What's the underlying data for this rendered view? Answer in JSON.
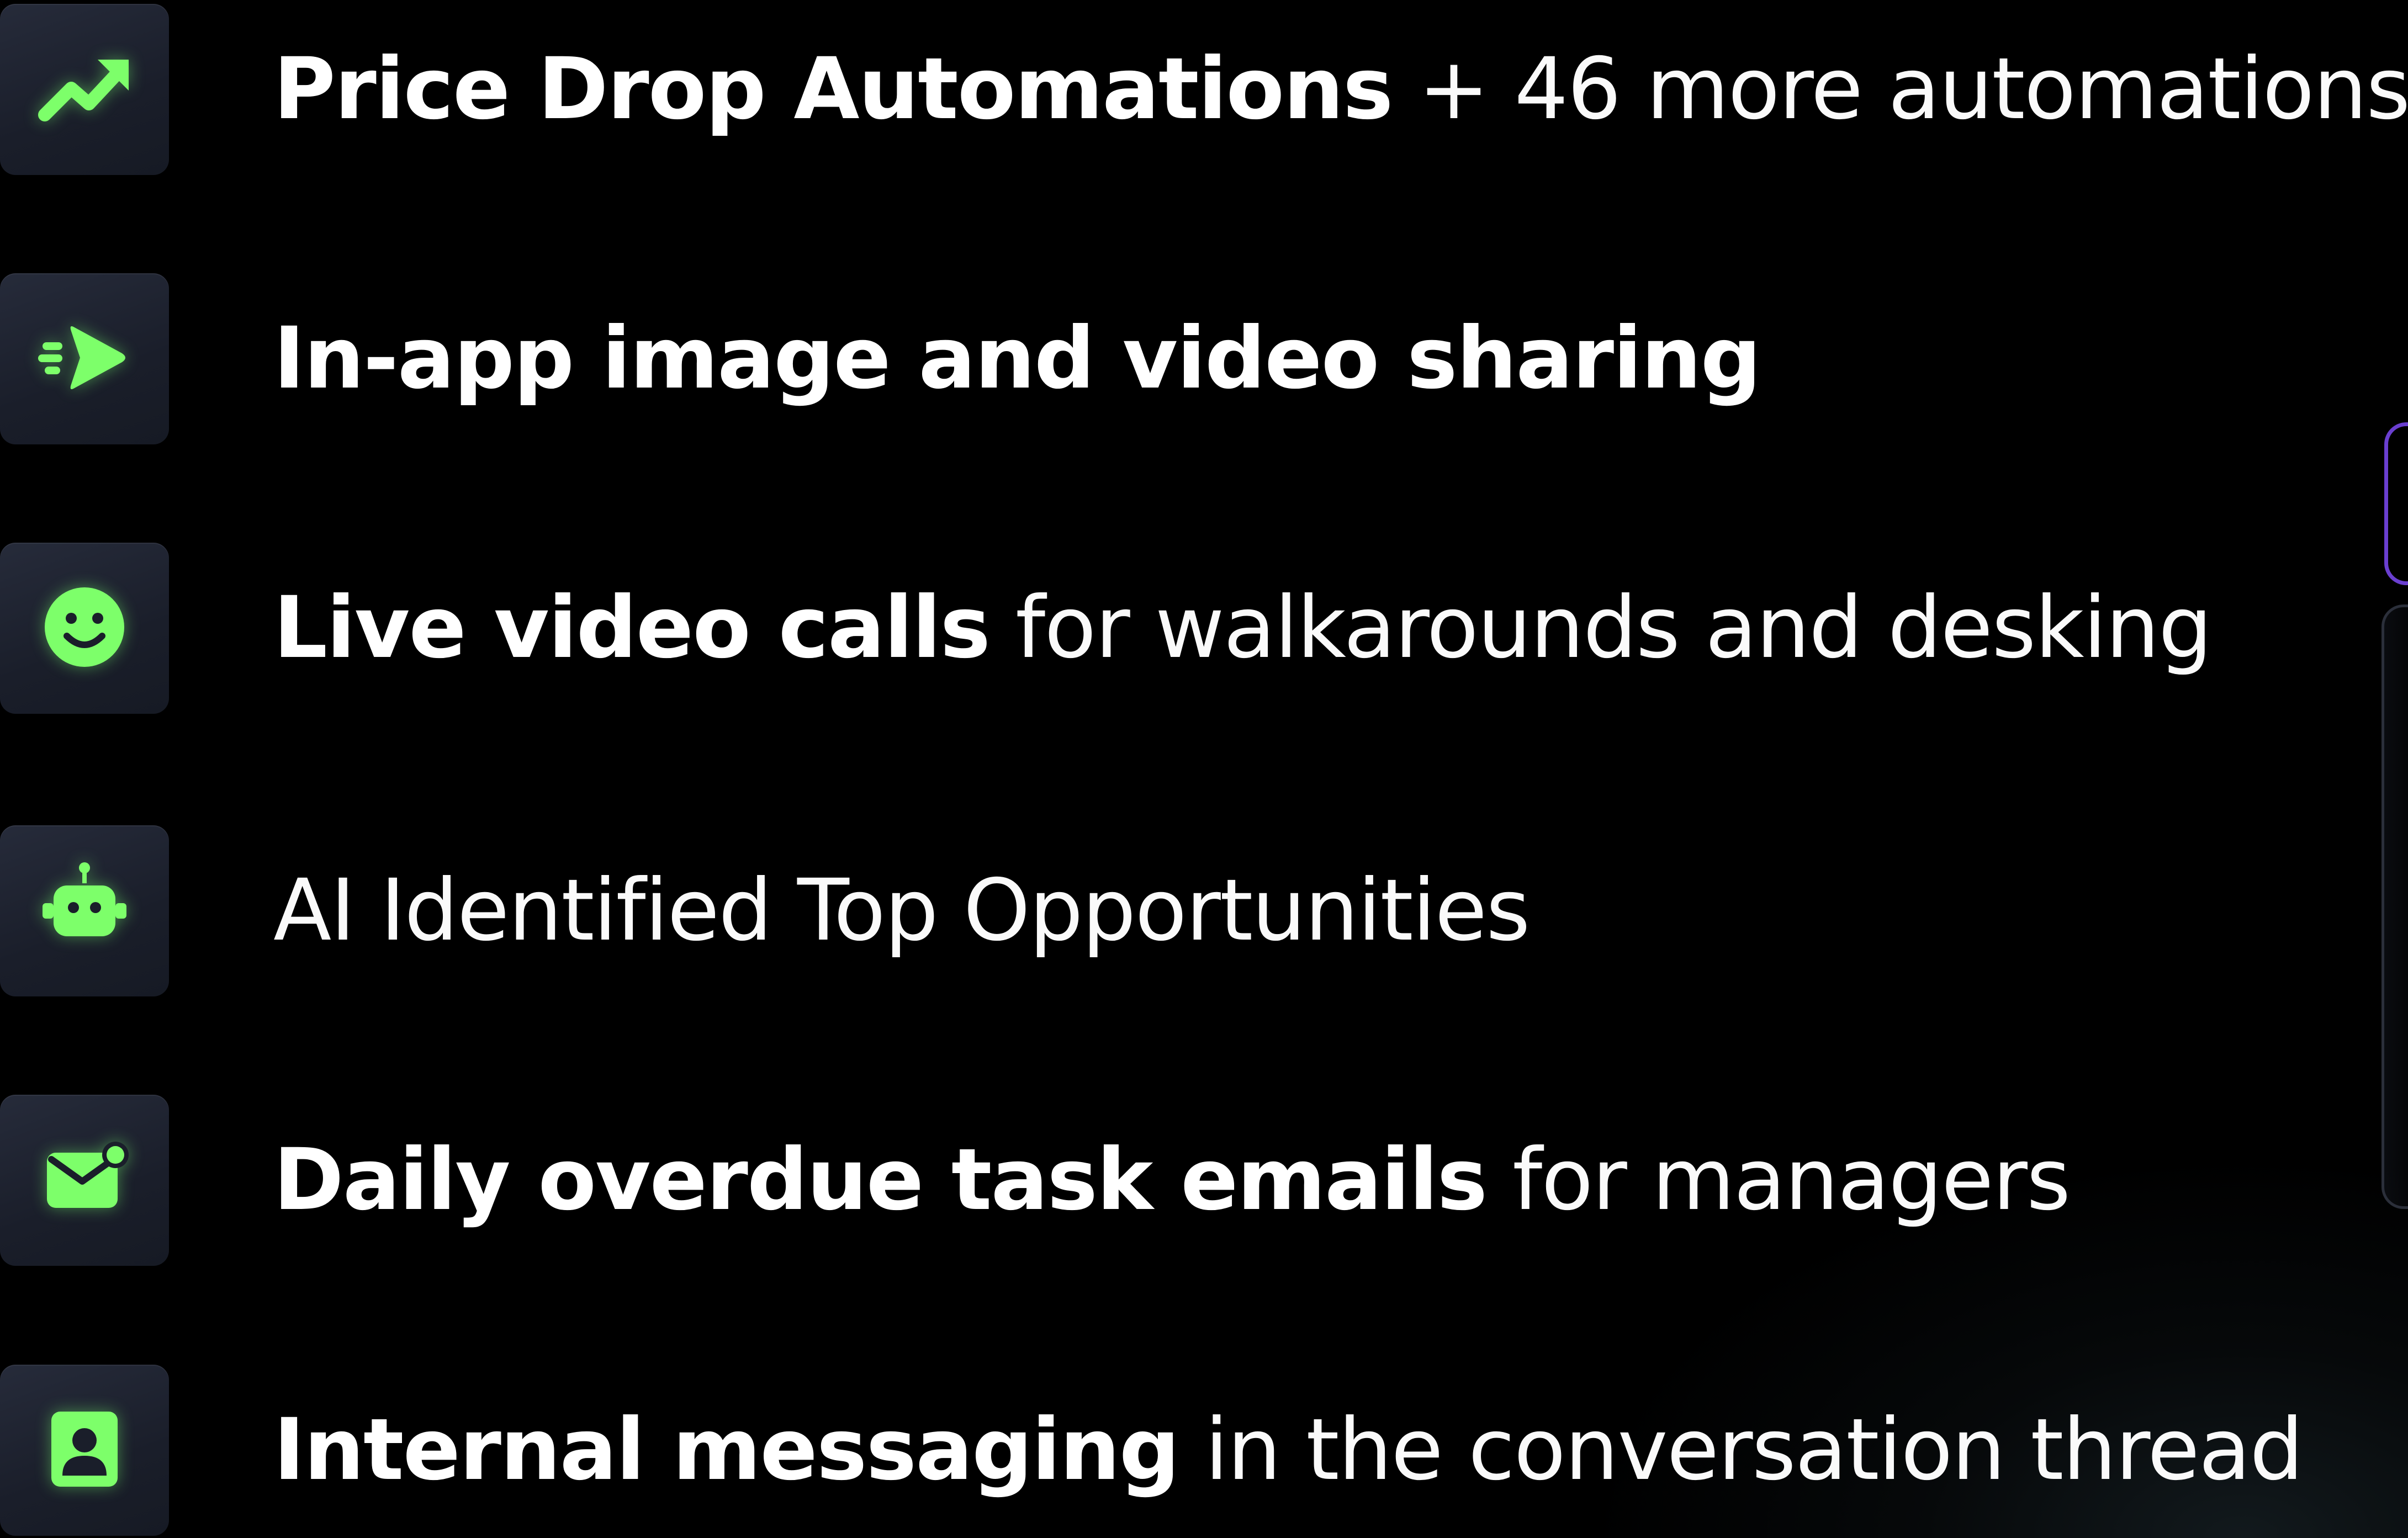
{
  "features": [
    {
      "icon": "trending-up-icon",
      "bold": "Price Drop Automations",
      "regular": " + 46 more automations"
    },
    {
      "icon": "send-arrow-icon",
      "bold": "In-app image and video sharing",
      "regular": ""
    },
    {
      "icon": "smiley-icon",
      "bold": "Live video calls",
      "regular": " for walkarounds and desking"
    },
    {
      "icon": "robot-icon",
      "bold": "",
      "regular": "AI Identified Top Opportunities"
    },
    {
      "icon": "mail-notification-icon",
      "bold": "Daily overdue task emails",
      "regular": " for managers"
    },
    {
      "icon": "contact-card-icon",
      "bold": "Internal messaging",
      "regular": " in the conversation thread"
    }
  ],
  "colors": {
    "background": "#000000",
    "icon_accent": "#7dff6a",
    "icon_tile": "#1e2230",
    "text": "#ffffff",
    "edge_accent": "#6a3fd0"
  }
}
